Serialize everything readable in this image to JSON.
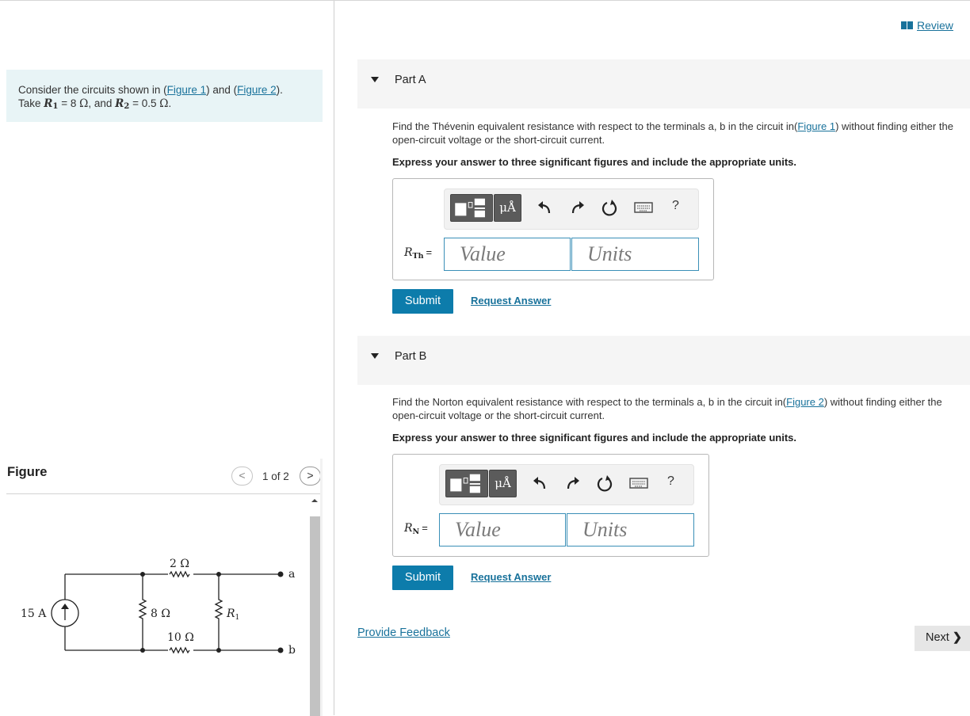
{
  "problem": {
    "prefix": "Consider the circuits shown in (",
    "figure1_link": "Figure 1",
    "middle": ") and (",
    "figure2_link": "Figure 2",
    "suffix": ").",
    "take_text": "Take",
    "r1_symbol": "R",
    "r1_sub": "1",
    "r1_value": " = 8 ",
    "ohm": "Ω",
    "and_text": ", and",
    "r2_symbol": "R",
    "r2_sub": "2",
    "r2_value": " = 0.5 ",
    "period": "."
  },
  "figure_panel": {
    "heading": "Figure",
    "prev_icon": "<",
    "counter": "1 of 2",
    "next_icon": ">",
    "circuit": {
      "source_label": "15 A",
      "r_top": "2 Ω",
      "r_left": "8 Ω",
      "r_bottom": "10 Ω",
      "r1_symbol": "R",
      "r1_sub": "1",
      "terminal_a": "a",
      "terminal_b": "b"
    }
  },
  "review": {
    "label": "Review",
    "icon": "book-icon"
  },
  "parts": [
    {
      "title": "Part A",
      "question_prefix": "Find the Thévenin equivalent resistance with respect to the terminals a, b in the circuit in(",
      "question_link": "Figure 1",
      "question_suffix": ") without finding either the open-circuit voltage or the short-circuit current.",
      "instruction": "Express your answer to three significant figures and include the appropriate units.",
      "var_symbol": "R",
      "var_sub": "Th",
      "equals": "=",
      "value_placeholder": "Value",
      "units_placeholder": "Units",
      "units_button": "μÅ",
      "help": "?",
      "submit": "Submit",
      "request": "Request Answer"
    },
    {
      "title": "Part B",
      "question_prefix": "Find the Norton equivalent resistance with respect to the terminals a, b in the circuit in(",
      "question_link": "Figure 2",
      "question_suffix": ") without finding either the open-circuit voltage or the short-circuit current.",
      "instruction": "Express your answer to three significant figures and include the appropriate units.",
      "var_symbol": "R",
      "var_sub": "N",
      "equals": "=",
      "value_placeholder": "Value",
      "units_placeholder": "Units",
      "units_button": "μÅ",
      "help": "?",
      "submit": "Submit",
      "request": "Request Answer"
    }
  ],
  "footer": {
    "feedback": "Provide Feedback",
    "next": "Next",
    "next_icon": "❯"
  },
  "colors": {
    "link": "#19729b",
    "submit": "#0d7cab",
    "intro_bg": "#e8f4f6",
    "field_border": "#3a8fb7"
  }
}
